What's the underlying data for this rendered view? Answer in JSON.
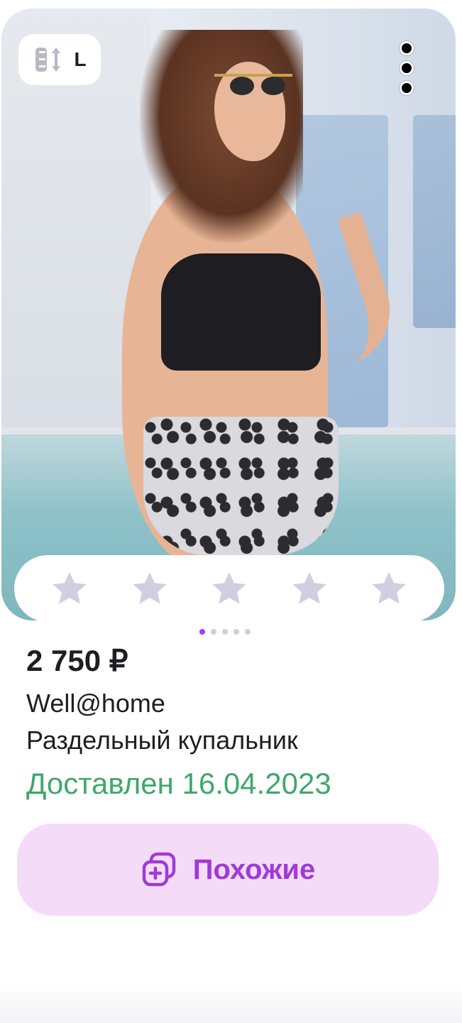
{
  "product_card": {
    "image_alt_icon": "product-photo",
    "size_badge": {
      "icon": "size-arrows-icon",
      "label": "L"
    },
    "menu_icon": "more-vertical-icon",
    "rating": {
      "stars_filled": 0,
      "stars_total": 5,
      "star_color": "#cfcfe0"
    },
    "carousel": {
      "total": 5,
      "active": 1
    },
    "price": "2 750 ₽",
    "brand": "Well@home",
    "title": "Раздельный купальник",
    "status": "Доставлен 16.04.2023",
    "status_color": "#3fa86a",
    "similar_button": {
      "label": "Похожие",
      "icon": "add-similar-icon",
      "color": "#a03ad6",
      "background": "#f4dcf9"
    }
  }
}
